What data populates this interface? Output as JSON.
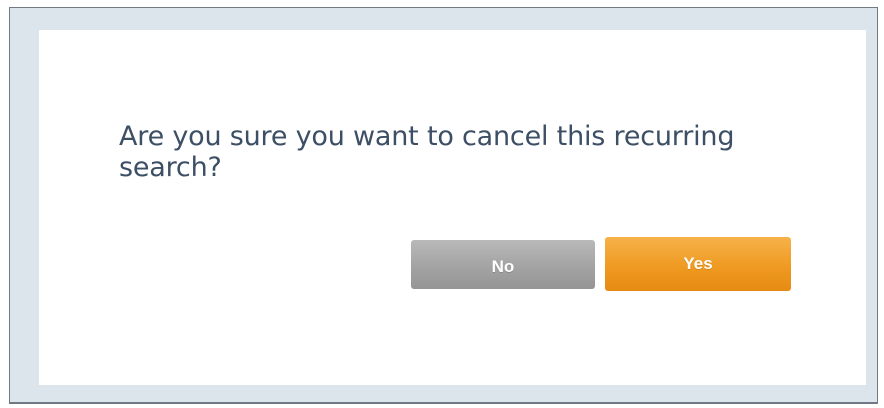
{
  "dialog": {
    "question": "Are you sure you want to cancel this recurring search?",
    "no_label": "No",
    "yes_label": "Yes"
  },
  "colors": {
    "question_text": "#3d4f65",
    "no_button": "#a3a3a3",
    "yes_button": "#ef9a22",
    "frame_background": "#dde5ec"
  }
}
